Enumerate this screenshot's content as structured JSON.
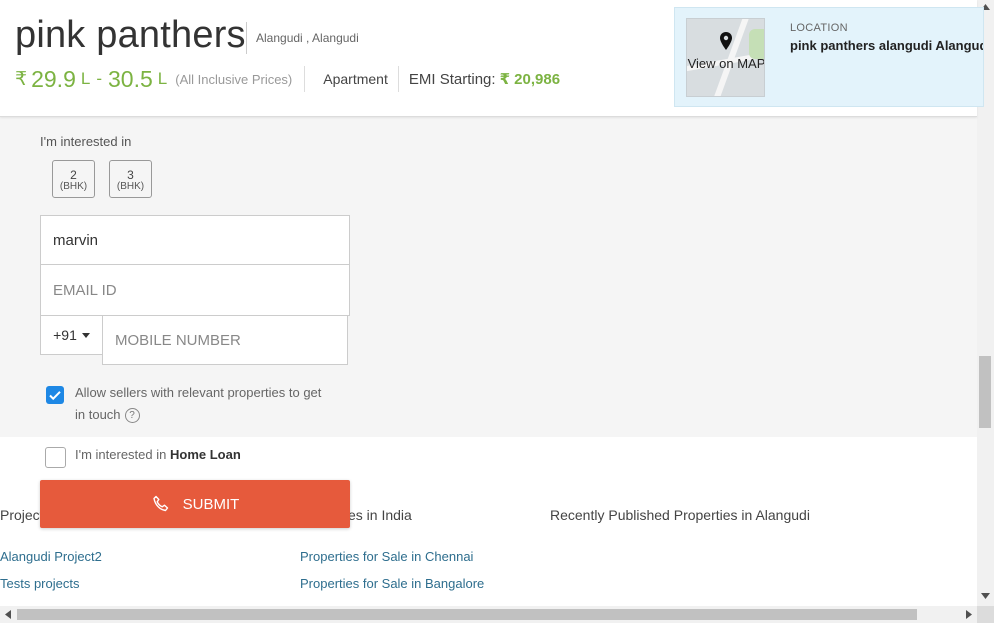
{
  "header": {
    "title": "pink panthers",
    "locality": "Alangudi , Alangudi",
    "price": {
      "currency": "₹",
      "min": "29.9",
      "min_unit": "L",
      "separator": "-",
      "max": "30.5",
      "max_unit": "L",
      "note": "(All Inclusive Prices)"
    },
    "property_type": "Apartment",
    "emi_label": "EMI Starting:",
    "emi_value": "₹ 20,986"
  },
  "location_panel": {
    "map_label": "View on MAP",
    "label": "LOCATION",
    "value": "pink panthers alangudi Alangudi"
  },
  "form": {
    "interest_label": "I'm interested in",
    "bhk_options": [
      {
        "number": "2",
        "unit": "(BHK)"
      },
      {
        "number": "3",
        "unit": "(BHK)"
      }
    ],
    "name_value": "marvin",
    "email_placeholder": "EMAIL ID",
    "country_code": "+91",
    "mobile_placeholder": "MOBILE NUMBER",
    "allow_sellers_text": "Allow sellers with relevant properties to get in touch",
    "allow_sellers_checked": true,
    "home_loan_prefix": "I'm interested in",
    "home_loan_bold": "Home Loan",
    "home_loan_checked": false,
    "submit_label": "SUBMIT"
  },
  "footer": {
    "col1_heading": "Project",
    "col2_heading": "es in India",
    "col3_heading": "Recently Published Properties in Alangudi",
    "col1_links": [
      "Alangudi Project2",
      "Tests projects"
    ],
    "col2_links": [
      "Properties for Sale in Chennai",
      "Properties for Sale in Bangalore"
    ]
  },
  "colors": {
    "price_green": "#7cb342",
    "submit_orange": "#e65a3c",
    "checkbox_blue": "#1e88e5",
    "link_blue": "#2e6e8e",
    "location_bg": "#e3f3fb"
  },
  "icons": {
    "map_pin": "map-pin-icon",
    "phone": "phone-icon",
    "help": "question-circle-icon",
    "check": "checkmark-icon",
    "caret": "caret-down-icon"
  }
}
